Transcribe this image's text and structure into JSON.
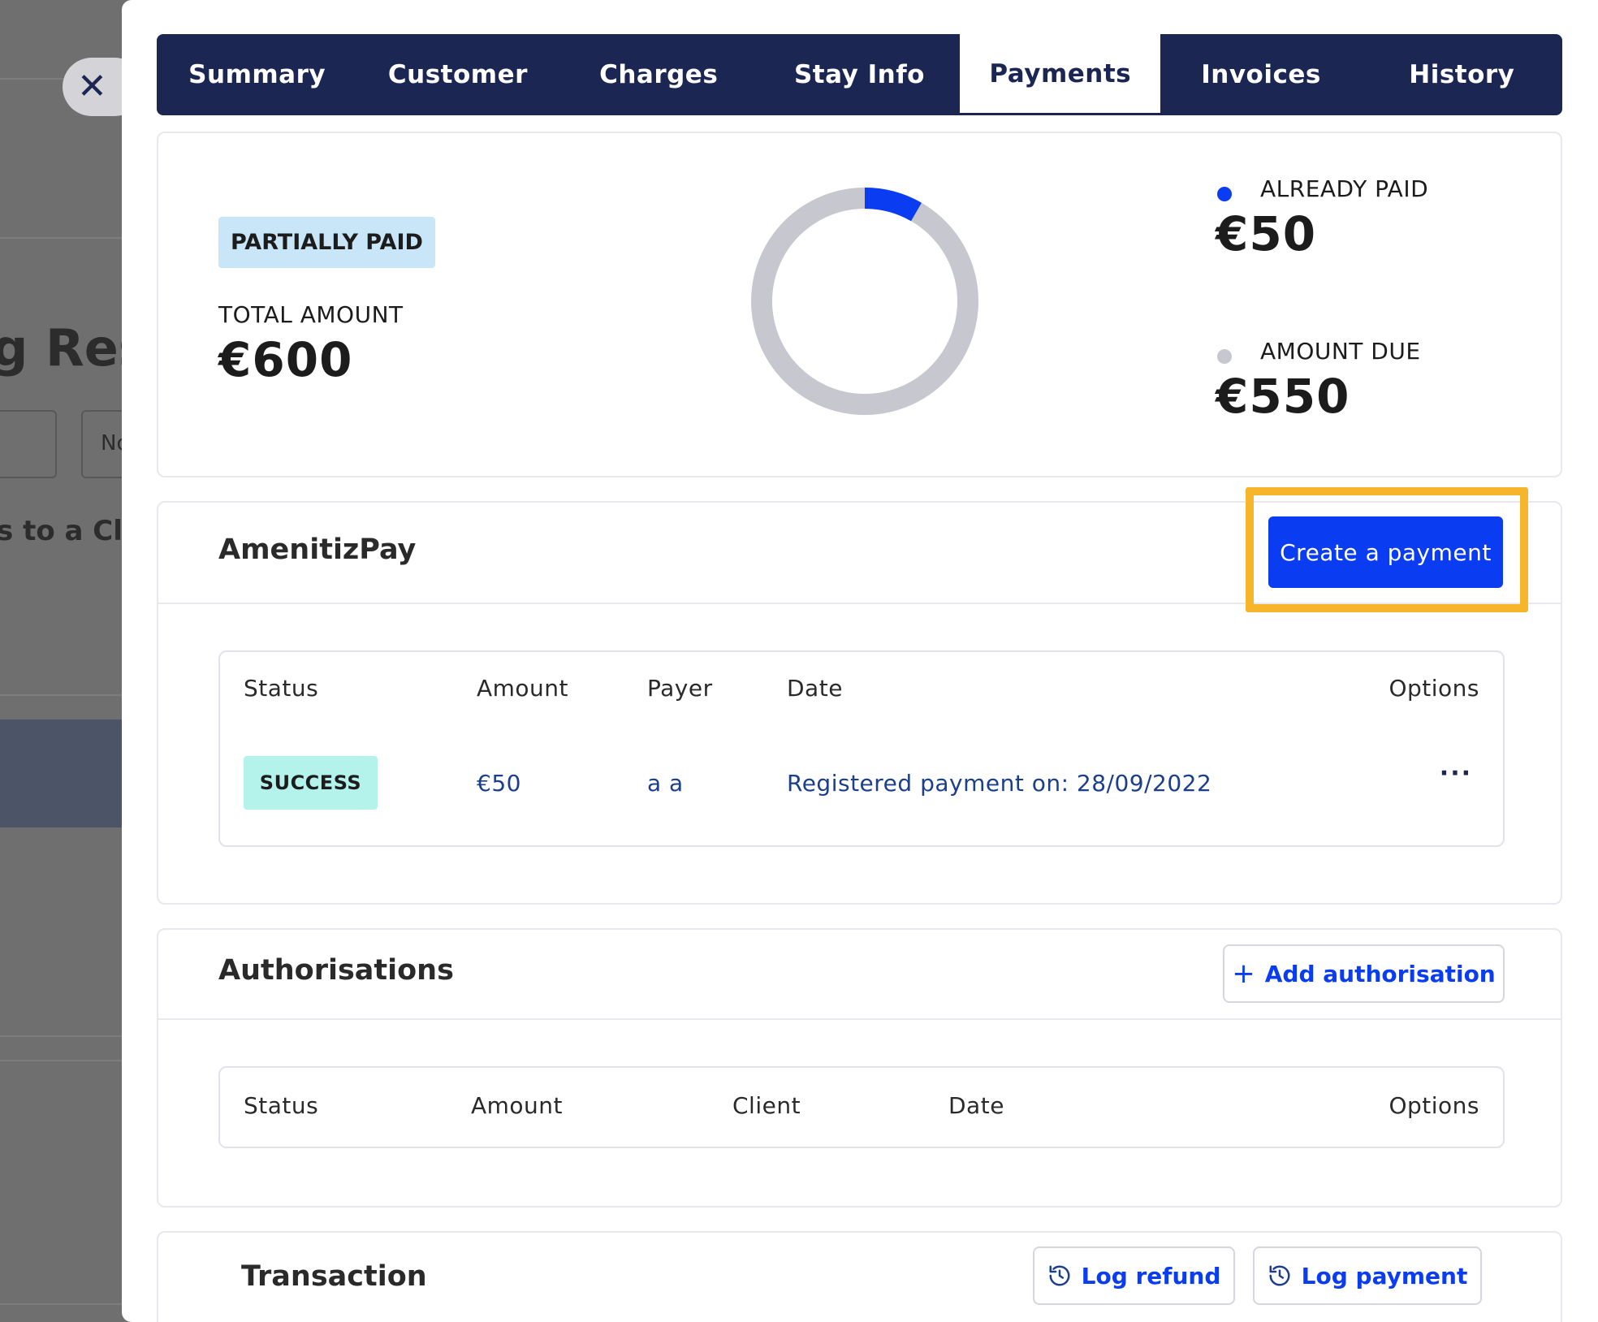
{
  "background": {
    "title_fragment": "g Rese",
    "subtitle_fragment": "s to a Clie",
    "input_fragment": "No"
  },
  "close_button": {
    "icon": "close-icon",
    "symbol": "✕"
  },
  "tabs": [
    {
      "label": "Summary",
      "active": false
    },
    {
      "label": "Customer",
      "active": false
    },
    {
      "label": "Charges",
      "active": false
    },
    {
      "label": "Stay Info",
      "active": false
    },
    {
      "label": "Payments",
      "active": true
    },
    {
      "label": "Invoices",
      "active": false
    },
    {
      "label": "History",
      "active": false
    }
  ],
  "summary": {
    "status": "PARTIALLY PAID",
    "total_label": "TOTAL AMOUNT",
    "total_value": "€600",
    "already_paid_label": "ALREADY PAID",
    "already_paid_value": "€50",
    "amount_due_label": "AMOUNT DUE",
    "amount_due_value": "€550",
    "paid_fraction": 0.0833,
    "colors": {
      "paid": "#0a3cf2",
      "due": "#c7c8cf",
      "status_bg": "#c9e6f8"
    }
  },
  "amenitizpay": {
    "title": "AmenitizPay",
    "create_button": "Create a payment",
    "columns": [
      "Status",
      "Amount",
      "Payer",
      "Date",
      "Options"
    ],
    "rows": [
      {
        "status": "SUCCESS",
        "amount": "€50",
        "payer": "a a",
        "date": "Registered payment on: 28/09/2022",
        "options": "···"
      }
    ]
  },
  "authorisations": {
    "title": "Authorisations",
    "add_button": "Add authorisation",
    "add_icon": "plus-icon",
    "columns": [
      "Status",
      "Amount",
      "Client",
      "Date",
      "Options"
    ]
  },
  "transaction": {
    "title": "Transaction",
    "log_refund": "Log refund",
    "log_payment": "Log payment",
    "button_icon": "history-icon"
  },
  "colors": {
    "navy": "#1b2652",
    "primary": "#0a3cf2",
    "highlight": "#f6b52b",
    "success_bg": "#b4f2ec"
  }
}
